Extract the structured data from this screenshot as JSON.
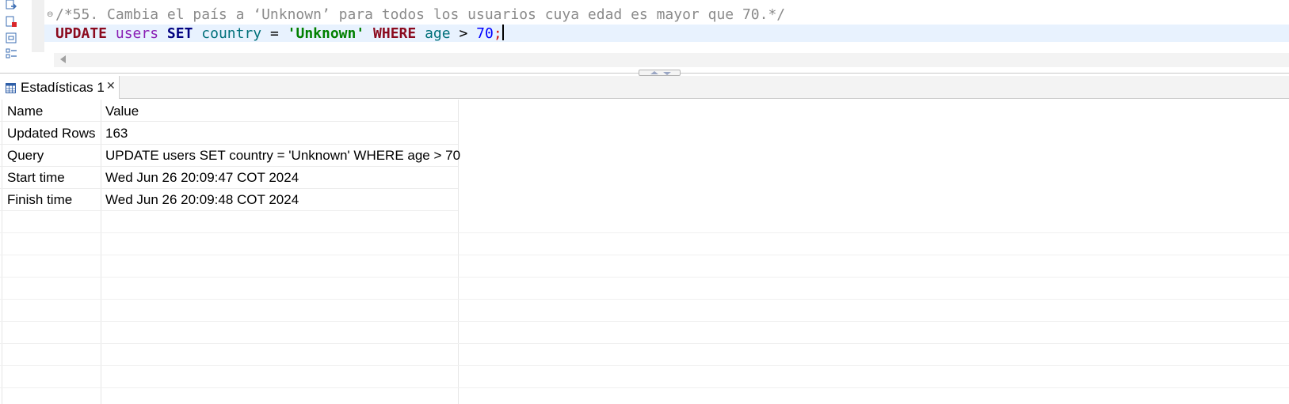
{
  "editor": {
    "comment_line": "/*55. Cambia el país a ‘Unknown’ para todos los usuarios cuya edad es mayor que 70.*/",
    "sql_tokens": {
      "update": "UPDATE",
      "table": "users",
      "set": "SET",
      "column": "country",
      "equals": "=",
      "value": "'Unknown'",
      "where": "WHERE",
      "condition_column": "age",
      "gt": ">",
      "number": "70",
      "semicolon": ";"
    },
    "fold_marker": "⊖"
  },
  "results": {
    "tab_label": "Estadísticas 1",
    "tab_close": "✕",
    "columns": [
      "Name",
      "Value"
    ],
    "rows": [
      {
        "name": "Updated Rows",
        "value": "163"
      },
      {
        "name": "Query",
        "value": "UPDATE users SET country = 'Unknown' WHERE age > 70"
      },
      {
        "name": "Start time",
        "value": "Wed Jun 26 20:09:47 COT 2024"
      },
      {
        "name": "Finish time",
        "value": "Wed Jun 26 20:09:48 COT 2024"
      }
    ]
  },
  "colors": {
    "current_line_highlight": "#e8f2fe",
    "keyword": "#8b0a1e",
    "string": "#008000",
    "number": "#0000ff",
    "comment": "#8b8b8b"
  }
}
